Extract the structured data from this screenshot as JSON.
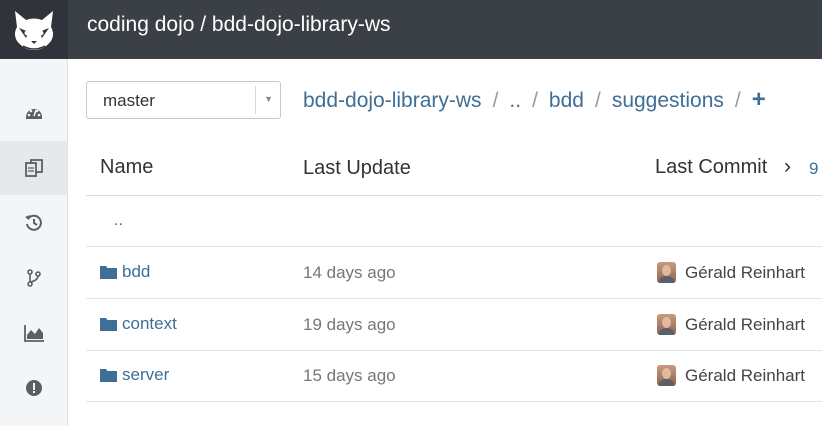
{
  "header": {
    "title": "coding dojo / bdd-dojo-library-ws"
  },
  "sidebar": {
    "items": [
      {
        "icon": "dashboard-icon"
      },
      {
        "icon": "files-icon",
        "active": true
      },
      {
        "icon": "history-icon"
      },
      {
        "icon": "branch-icon"
      },
      {
        "icon": "chart-icon"
      },
      {
        "icon": "issues-icon"
      }
    ]
  },
  "branch_select": {
    "value": "master"
  },
  "breadcrumb": {
    "repo": "bdd-dojo-library-ws",
    "parent": "..",
    "dir": "bdd",
    "current": "suggestions",
    "separator": "/",
    "add": "+"
  },
  "table": {
    "columns": {
      "name": "Name",
      "last_update": "Last Update",
      "last_commit": "Last Commit",
      "commit_overflow": "›",
      "commit_hash": "9"
    },
    "up": "..",
    "rows": [
      {
        "name": "bdd",
        "updated": "14 days ago",
        "author": "Gérald Reinhart"
      },
      {
        "name": "context",
        "updated": "19 days ago",
        "author": "Gérald Reinhart"
      },
      {
        "name": "server",
        "updated": "15 days ago",
        "author": "Gérald Reinhart"
      }
    ]
  },
  "colors": {
    "topbar": "#3b4047",
    "link": "#3f6e96"
  }
}
